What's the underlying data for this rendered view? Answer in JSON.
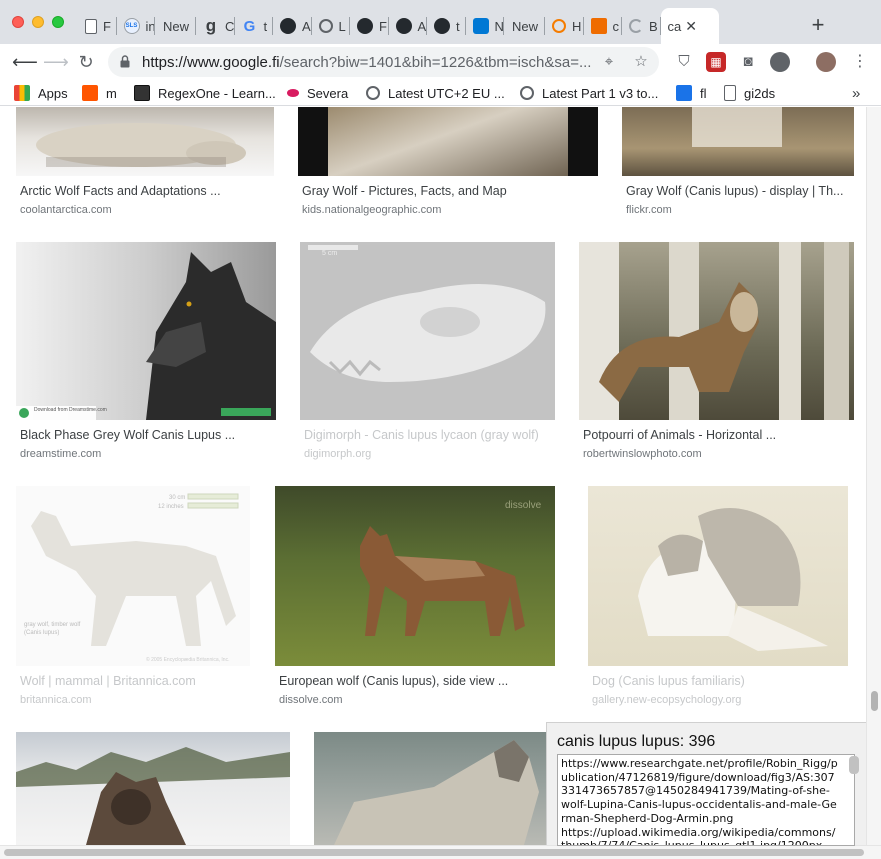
{
  "tabs": [
    {
      "favicon": "doc-icon",
      "label": "F"
    },
    {
      "favicon": "sls-icon",
      "label": "in"
    },
    {
      "favicon": "",
      "label": "New"
    },
    {
      "favicon": "g-icon",
      "label": "C"
    },
    {
      "favicon": "google-icon",
      "label": "t"
    },
    {
      "favicon": "github-icon",
      "label": "A"
    },
    {
      "favicon": "search-tab-icon",
      "label": "L"
    },
    {
      "favicon": "github-icon",
      "label": "F"
    },
    {
      "favicon": "github-icon",
      "label": "A"
    },
    {
      "favicon": "github-icon",
      "label": "t"
    },
    {
      "favicon": "vscode-icon",
      "label": "N"
    },
    {
      "favicon": "",
      "label": "New"
    },
    {
      "favicon": "orange-ring-icon",
      "label": "H"
    },
    {
      "favicon": "book-icon",
      "label": "c"
    },
    {
      "favicon": "loading-icon",
      "label": "B"
    },
    {
      "favicon": "",
      "label": "ca",
      "active": true
    }
  ],
  "toolbar": {
    "url_host": "https://www.google.fi",
    "url_path": "/search?biw=1401&bih=1226&tbm=isch&sa=..."
  },
  "bookmarks": [
    {
      "icon": "apps-grid-icon",
      "label": "Apps"
    },
    {
      "icon": "soundcloud-icon",
      "label": "m"
    },
    {
      "icon": "regexone-icon",
      "label": "RegexOne - Learn..."
    },
    {
      "icon": "severa-icon",
      "label": "Severa"
    },
    {
      "icon": "globe-icon",
      "label": "Latest UTC+2 EU ..."
    },
    {
      "icon": "globe-icon",
      "label": "Latest Part 1 v3 to..."
    },
    {
      "icon": "doc-blue-icon",
      "label": "fl"
    },
    {
      "icon": "page-icon",
      "label": "gi2ds"
    }
  ],
  "results": [
    {
      "title": "Arctic Wolf Facts and Adaptations ...",
      "source": "coolantarctica.com",
      "faded": false
    },
    {
      "title": "Gray Wolf - Pictures, Facts, and Map",
      "source": "kids.nationalgeographic.com",
      "faded": false
    },
    {
      "title": "Gray Wolf (Canis lupus) - display | Th...",
      "source": "flickr.com",
      "faded": false
    },
    {
      "title": "Black Phase Grey Wolf Canis Lupus ...",
      "source": "dreamstime.com",
      "faded": false
    },
    {
      "title": "Digimorph - Canis lupus lycaon (gray wolf)",
      "source": "digimorph.org",
      "faded": true
    },
    {
      "title": "Potpourri of Animals - Horizontal ...",
      "source": "robertwinslowphoto.com",
      "faded": false
    },
    {
      "title": "Wolf | mammal | Britannica.com",
      "source": "britannica.com",
      "faded": true
    },
    {
      "title": "European wolf (Canis lupus), side view ...",
      "source": "dissolve.com",
      "faded": false
    },
    {
      "title": "Dog (Canis lupus familiaris)",
      "source": "gallery.new-ecopsychology.org",
      "faded": true
    },
    {
      "title": "",
      "source": "",
      "faded": false
    },
    {
      "title": "",
      "source": "",
      "faded": false
    }
  ],
  "image_text": {
    "skull_scale": "5 cm",
    "dreamstime_note": "Download from Dreamstime.com",
    "britannica_scale_1": "30 cm",
    "britannica_scale_2": "12 inches",
    "britannica_label_1": "gray wolf, timber wolf",
    "britannica_label_2": "(Canis lupus)",
    "britannica_copy": "© 2005 Encyclopædia Britannica, Inc.",
    "dissolve_mark": "dissolve"
  },
  "panel": {
    "title": "canis lupus lupus: 396",
    "text": "https://www.researchgate.net/profile/Robin_Rigg/publication/47126819/figure/download/fig3/AS:307331473657857@1450284941739/Mating-of-she-wolf-Lupina-Canis-lupus-occidentalis-and-male-German-Shepherd-Dog-Armin.png\nhttps://upload.wikimedia.org/wikipedia/commons/thumb/7/74/Canis_lupus_lupus_qtl1.jpg/1200px-"
  }
}
